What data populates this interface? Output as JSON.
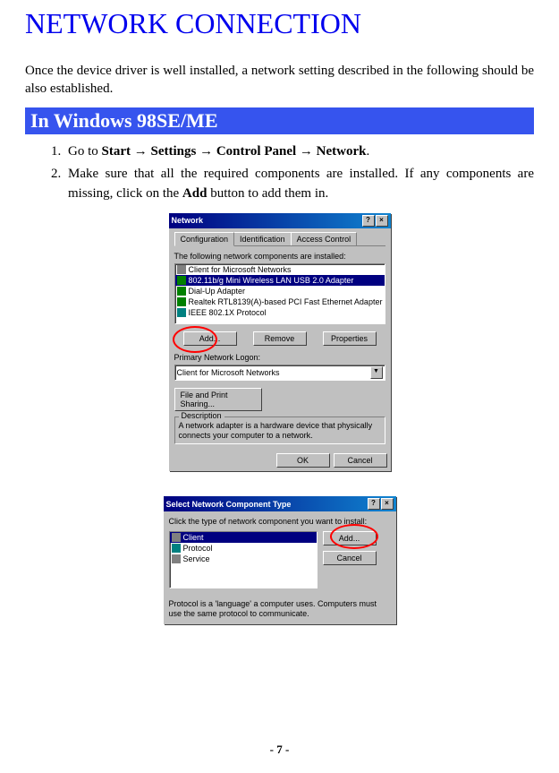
{
  "heading": "NETWORK CONNECTION",
  "intro": "Once the device driver is well installed, a network setting described in the following should be also established.",
  "section_header": "In Windows 98SE/ME",
  "steps": [
    {
      "prefix": "Go to ",
      "bold_parts": [
        "Start",
        "Settings",
        "Control Panel",
        "Network"
      ],
      "suffix": "."
    },
    {
      "text_before_bold": "Make sure that all the required components are installed. If any components are missing, click on the ",
      "bold": "Add",
      "text_after_bold": " button to add them in."
    }
  ],
  "dialog1": {
    "title": "Network",
    "tabs": [
      "Configuration",
      "Identification",
      "Access Control"
    ],
    "list_label": "The following network components are installed:",
    "components": [
      "Client for Microsoft Networks",
      "802.11b/g Mini Wireless LAN USB 2.0 Adapter",
      "Dial-Up Adapter",
      "Realtek RTL8139(A)-based PCI Fast Ethernet Adapter",
      "IEEE 802.1X Protocol"
    ],
    "selected_index": 1,
    "buttons": {
      "add": "Add...",
      "remove": "Remove",
      "properties": "Properties"
    },
    "logon_label": "Primary Network Logon:",
    "logon_value": "Client for Microsoft Networks",
    "fps_button": "File and Print Sharing...",
    "desc_label": "Description",
    "desc_text": "A network adapter is a hardware device that physically connects your computer to a network.",
    "ok": "OK",
    "cancel": "Cancel"
  },
  "dialog2": {
    "title": "Select Network Component Type",
    "prompt": "Click the type of network component you want to install:",
    "items": [
      "Client",
      "Protocol",
      "Service"
    ],
    "selected_index": 0,
    "add": "Add...",
    "cancel": "Cancel",
    "desc": "Protocol is a 'language' a computer uses. Computers must use the same protocol to communicate."
  },
  "page_number": "- 7 -"
}
